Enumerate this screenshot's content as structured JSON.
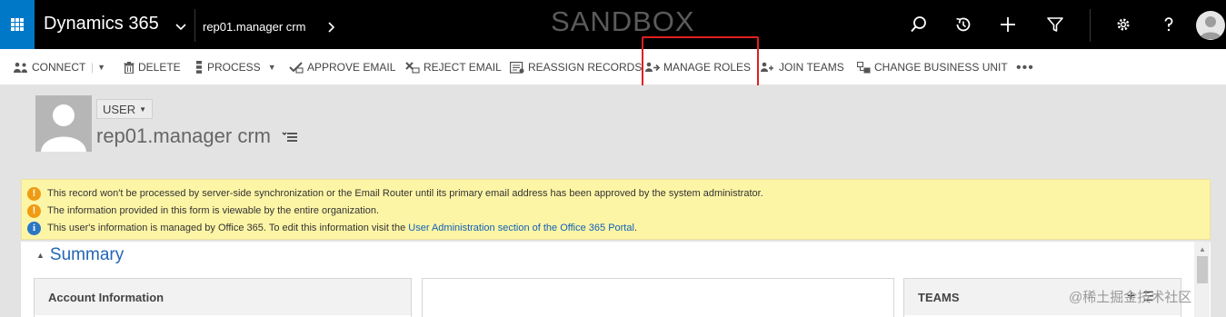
{
  "topbar": {
    "app_title": "Dynamics 365",
    "breadcrumb": "rep01.manager crm",
    "environment_label": "SANDBOX",
    "icons": [
      "app-launcher-icon",
      "search-icon",
      "recent-icon",
      "new-icon",
      "filter-icon",
      "settings-icon",
      "help-icon",
      "user-avatar-icon"
    ],
    "brand_color": "#0078c8"
  },
  "command_bar": {
    "connect": "CONNECT",
    "delete": "DELETE",
    "process": "PROCESS",
    "approve_email": "APPROVE EMAIL",
    "reject_email": "REJECT EMAIL",
    "reassign_records": "REASSIGN RECORDS",
    "manage_roles": "MANAGE ROLES",
    "join_teams": "JOIN TEAMS",
    "change_business_unit": "CHANGE BUSINESS UNIT",
    "more": "•••",
    "highlighted_item": "MANAGE ROLES",
    "highlight_color": "#e02020"
  },
  "header": {
    "entity_type": "USER",
    "record_name": "rep01.manager crm"
  },
  "notifications": [
    {
      "type": "warning",
      "text": "This record won't be processed by server-side synchronization or the Email Router until its primary email address has been approved by the system administrator."
    },
    {
      "type": "warning",
      "text": "The information provided in this form is viewable by the entire organization."
    },
    {
      "type": "info",
      "text": "This user's information is managed by Office 365. To edit this information visit the ",
      "link": "User Administration section of the Office 365 Portal",
      "suffix": "."
    }
  ],
  "form": {
    "section_title": "Summary",
    "account_panel_title": "Account Information",
    "teams_panel_title": "TEAMS"
  },
  "watermark": "@稀土掘金技术社区"
}
